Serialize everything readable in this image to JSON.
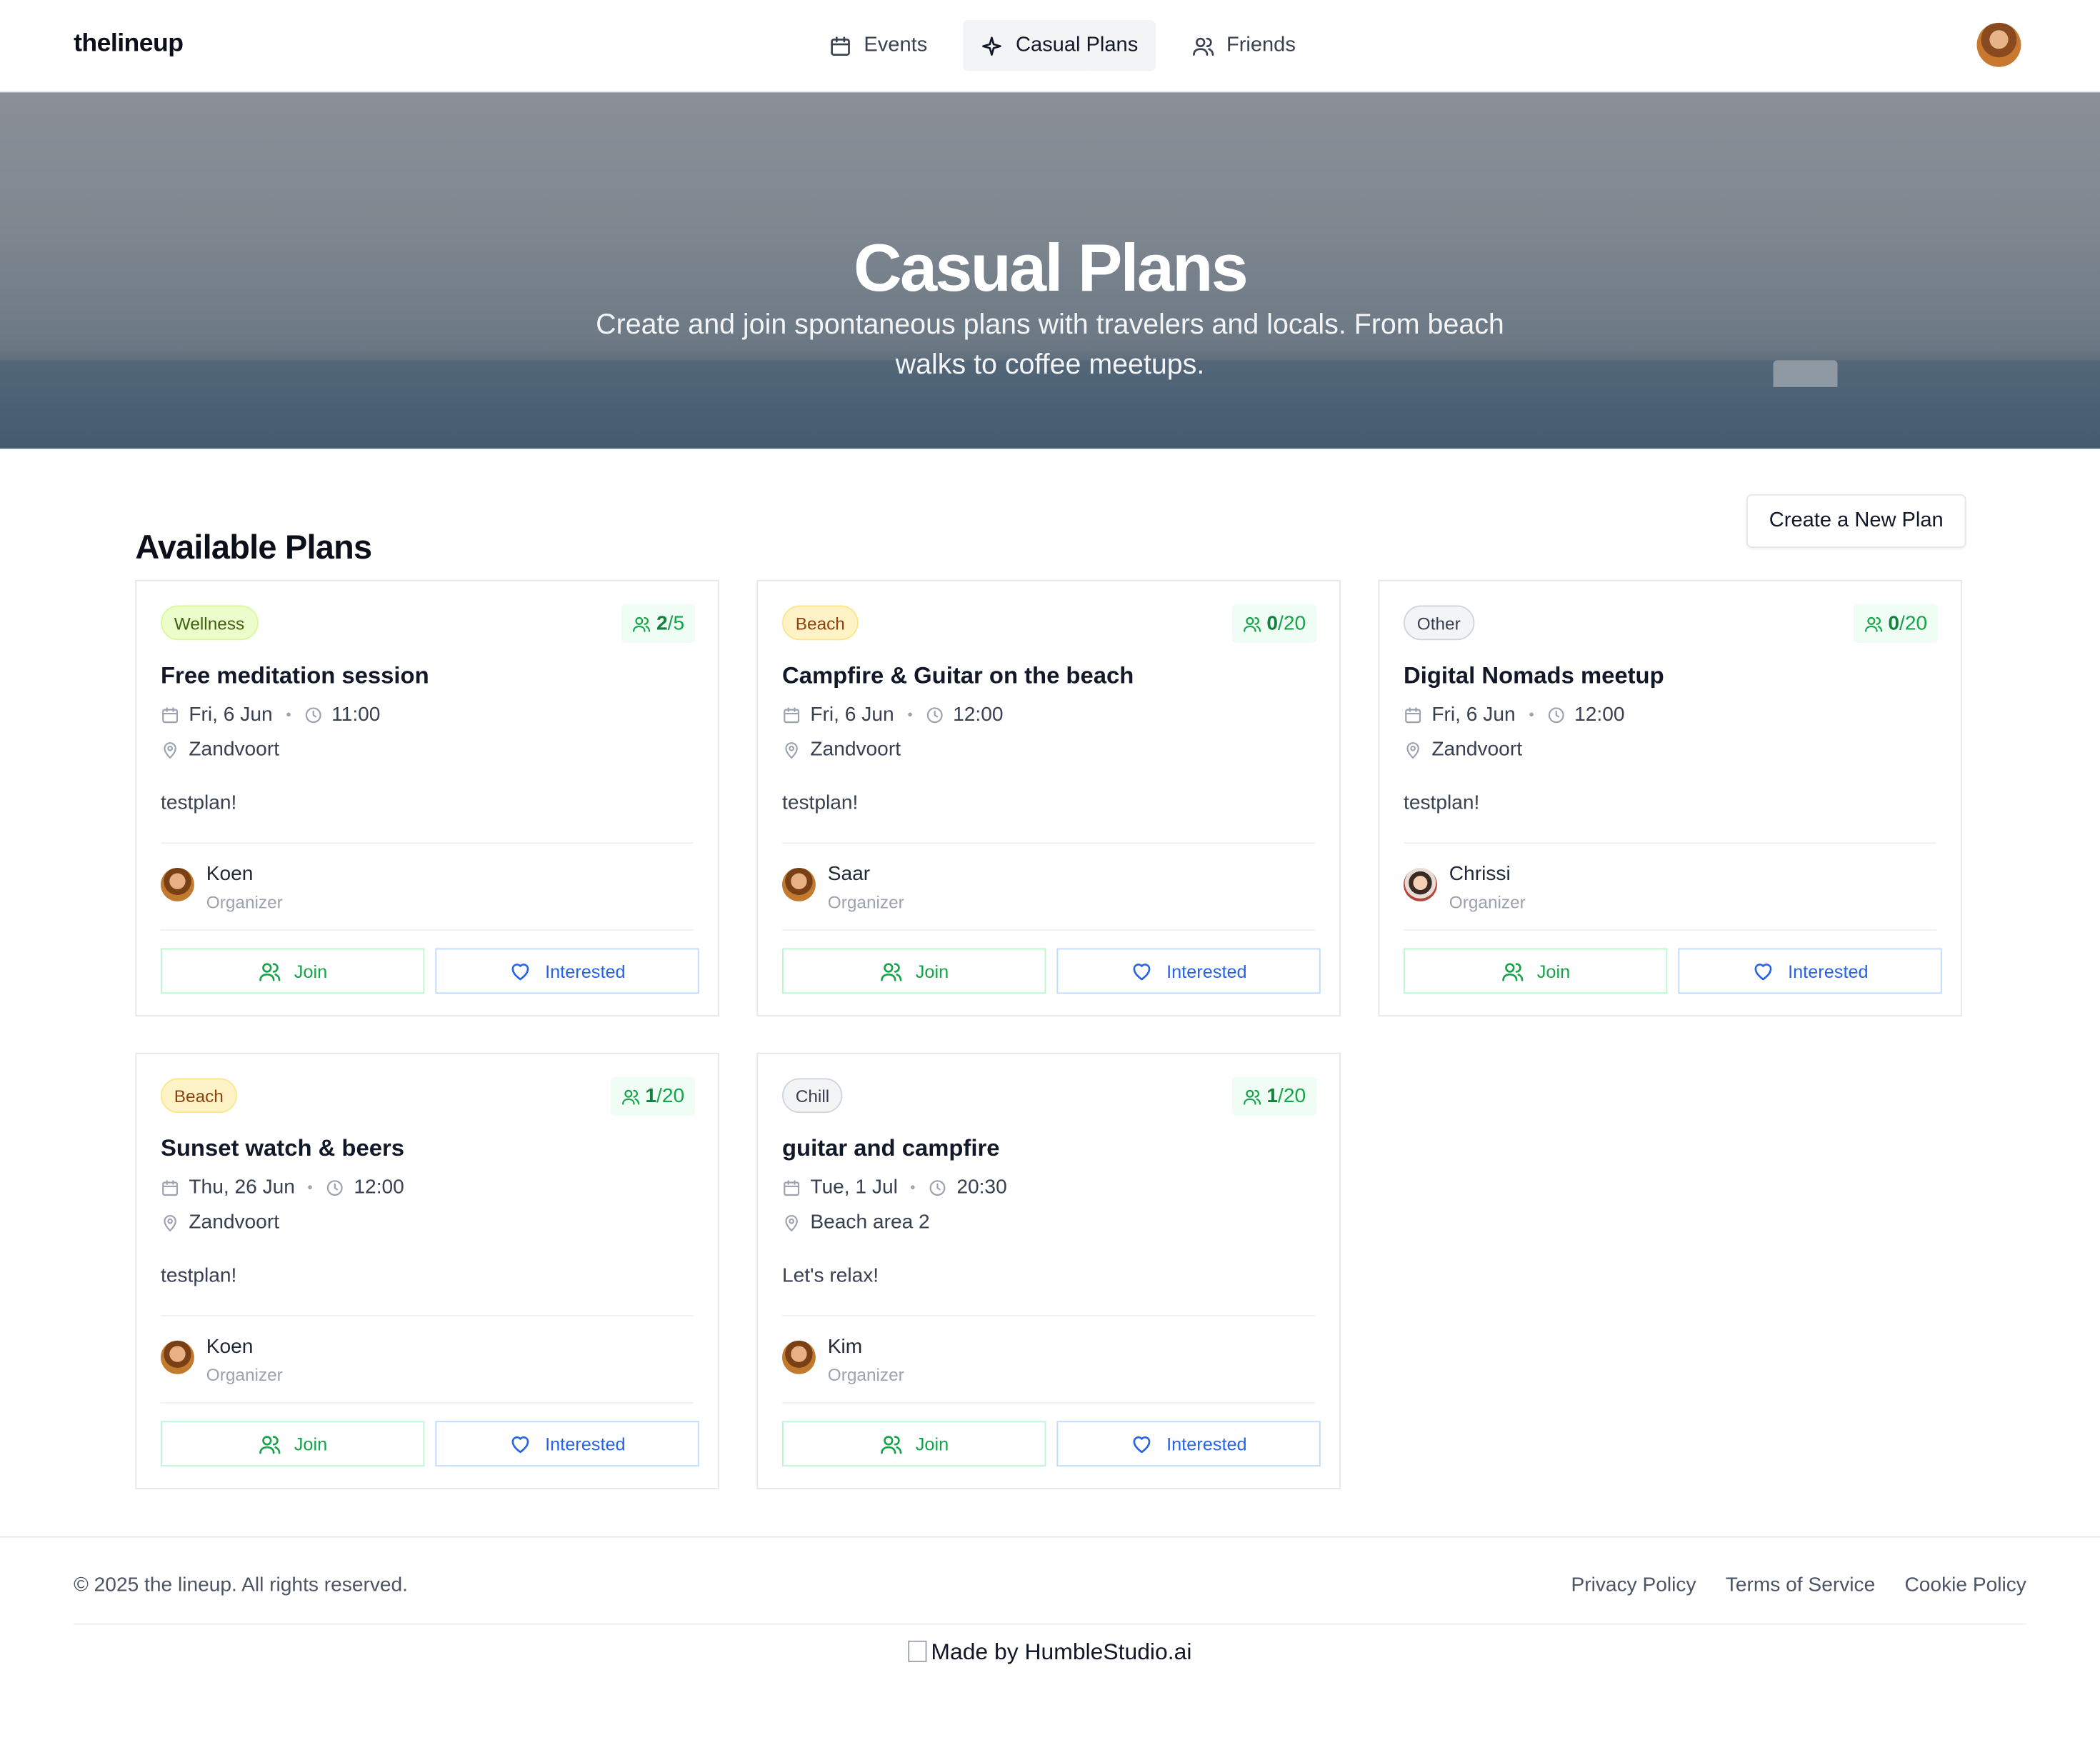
{
  "app": {
    "brand": "thelineup"
  },
  "nav": {
    "tabs": [
      {
        "label": "Events",
        "icon": "calendar-icon"
      },
      {
        "label": "Casual Plans",
        "icon": "sparkle-icon"
      },
      {
        "label": "Friends",
        "icon": "users-icon"
      }
    ],
    "active_tab": "Casual Plans"
  },
  "hero": {
    "title": "Casual Plans",
    "subtitle": "Create and join spontaneous plans with travelers and locals. From beach walks to coffee meetups."
  },
  "main": {
    "section_title": "Available Plans",
    "create_button": "Create a New Plan"
  },
  "plans": [
    {
      "category": "Wellness",
      "joined": "2",
      "capacity": "/5",
      "title": "Free meditation session",
      "date": "Fri, 6 Jun",
      "time": "11:00",
      "location": "Zandvoort",
      "description": "testplan!",
      "organizer": "Koen",
      "role": "Organizer",
      "join_label": "Join",
      "interested_label": "Interested"
    },
    {
      "category": "Beach",
      "joined": "0",
      "capacity": "/20",
      "title": "Campfire & Guitar on the beach",
      "date": "Fri, 6 Jun",
      "time": "12:00",
      "location": "Zandvoort",
      "description": "testplan!",
      "organizer": "Saar",
      "role": "Organizer",
      "join_label": "Join",
      "interested_label": "Interested"
    },
    {
      "category": "Other",
      "joined": "0",
      "capacity": "/20",
      "title": "Digital Nomads meetup",
      "date": "Fri, 6 Jun",
      "time": "12:00",
      "location": "Zandvoort",
      "description": "testplan!",
      "organizer": "Chrissi",
      "role": "Organizer",
      "join_label": "Join",
      "interested_label": "Interested"
    },
    {
      "category": "Beach",
      "joined": "1",
      "capacity": "/20",
      "title": "Sunset watch & beers",
      "date": "Thu, 26 Jun",
      "time": "12:00",
      "location": "Zandvoort",
      "description": "testplan!",
      "organizer": "Koen",
      "role": "Organizer",
      "join_label": "Join",
      "interested_label": "Interested"
    },
    {
      "category": "Chill",
      "joined": "1",
      "capacity": "/20",
      "title": "guitar and campfire",
      "date": "Tue, 1 Jul",
      "time": "20:30",
      "location": "Beach area 2",
      "description": "Let's relax!",
      "organizer": "Kim",
      "role": "Organizer",
      "join_label": "Join",
      "interested_label": "Interested"
    }
  ],
  "footer": {
    "copyright": "© 2025 the lineup. All rights reserved.",
    "links": [
      "Privacy Policy",
      "Terms of Service",
      "Cookie Policy"
    ],
    "made_by": "Made by HumbleStudio.ai"
  },
  "colors": {
    "join_green": "#16a34a",
    "interested_blue": "#2563eb",
    "wellness_tag": "#ecfccb",
    "beach_tag": "#fef3c7"
  }
}
